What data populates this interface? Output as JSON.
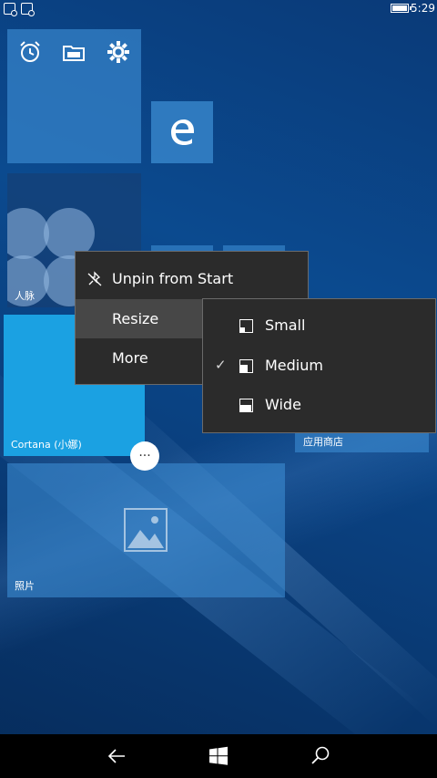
{
  "status_bar": {
    "time": "5:29"
  },
  "tiles": {
    "people": {
      "label": "人脉"
    },
    "cortana": {
      "label": "Cortana (小娜)"
    },
    "store": {
      "label": "应用商店"
    },
    "photos": {
      "label": "照片"
    },
    "more_button": "···"
  },
  "context_menu": {
    "items": [
      {
        "label": "Unpin from Start",
        "icon": "unpin-icon"
      },
      {
        "label": "Resize",
        "highlighted": true
      },
      {
        "label": "More"
      }
    ]
  },
  "resize_submenu": {
    "items": [
      {
        "label": "Small",
        "checked": false,
        "icon": "small-size-icon"
      },
      {
        "label": "Medium",
        "checked": true,
        "icon": "medium-size-icon"
      },
      {
        "label": "Wide",
        "checked": false,
        "icon": "wide-size-icon"
      }
    ],
    "check_glyph": "✓"
  },
  "nav_bar": {
    "back_icon": "back-icon",
    "start_icon": "windows-logo-icon",
    "search_icon": "search-icon"
  },
  "colors": {
    "cortana_tile": "#1ba1e2",
    "menu_bg": "#2b2b2b",
    "menu_highlight": "#474747"
  }
}
